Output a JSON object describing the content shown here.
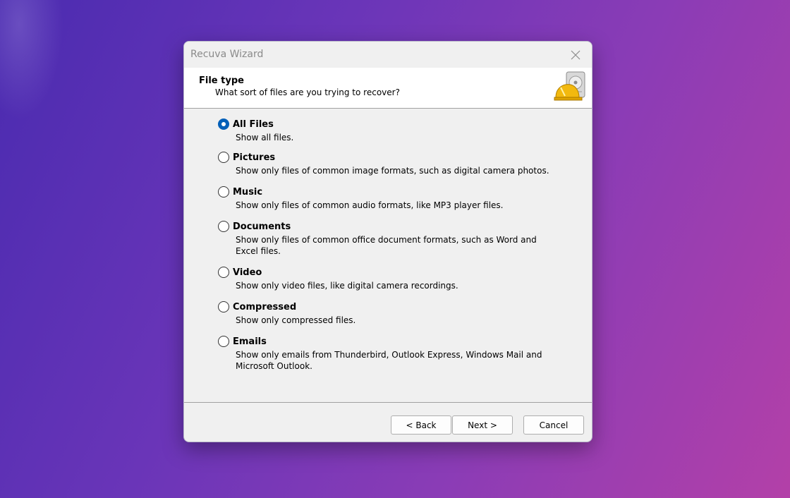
{
  "window": {
    "title": "Recuva Wizard"
  },
  "header": {
    "title": "File type",
    "subtitle": "What sort of files are you trying to recover?"
  },
  "options": [
    {
      "label": "All Files",
      "description": "Show all files.",
      "checked": true
    },
    {
      "label": "Pictures",
      "description": "Show only files of common image formats, such as digital camera photos.",
      "checked": false
    },
    {
      "label": "Music",
      "description": "Show only files of common audio formats, like MP3 player files.",
      "checked": false
    },
    {
      "label": "Documents",
      "description": "Show only files of common office document formats, such as Word and Excel files.",
      "checked": false
    },
    {
      "label": "Video",
      "description": "Show only video files, like digital camera recordings.",
      "checked": false
    },
    {
      "label": "Compressed",
      "description": "Show only compressed files.",
      "checked": false
    },
    {
      "label": "Emails",
      "description": "Show only emails from Thunderbird, Outlook Express, Windows Mail and Microsoft Outlook.",
      "checked": false
    }
  ],
  "buttons": {
    "back": "< Back",
    "next": "Next >",
    "cancel": "Cancel"
  },
  "icons": {
    "close": "close-icon",
    "logo": "recuva-logo-icon"
  },
  "colors": {
    "accent": "#005fb8"
  }
}
